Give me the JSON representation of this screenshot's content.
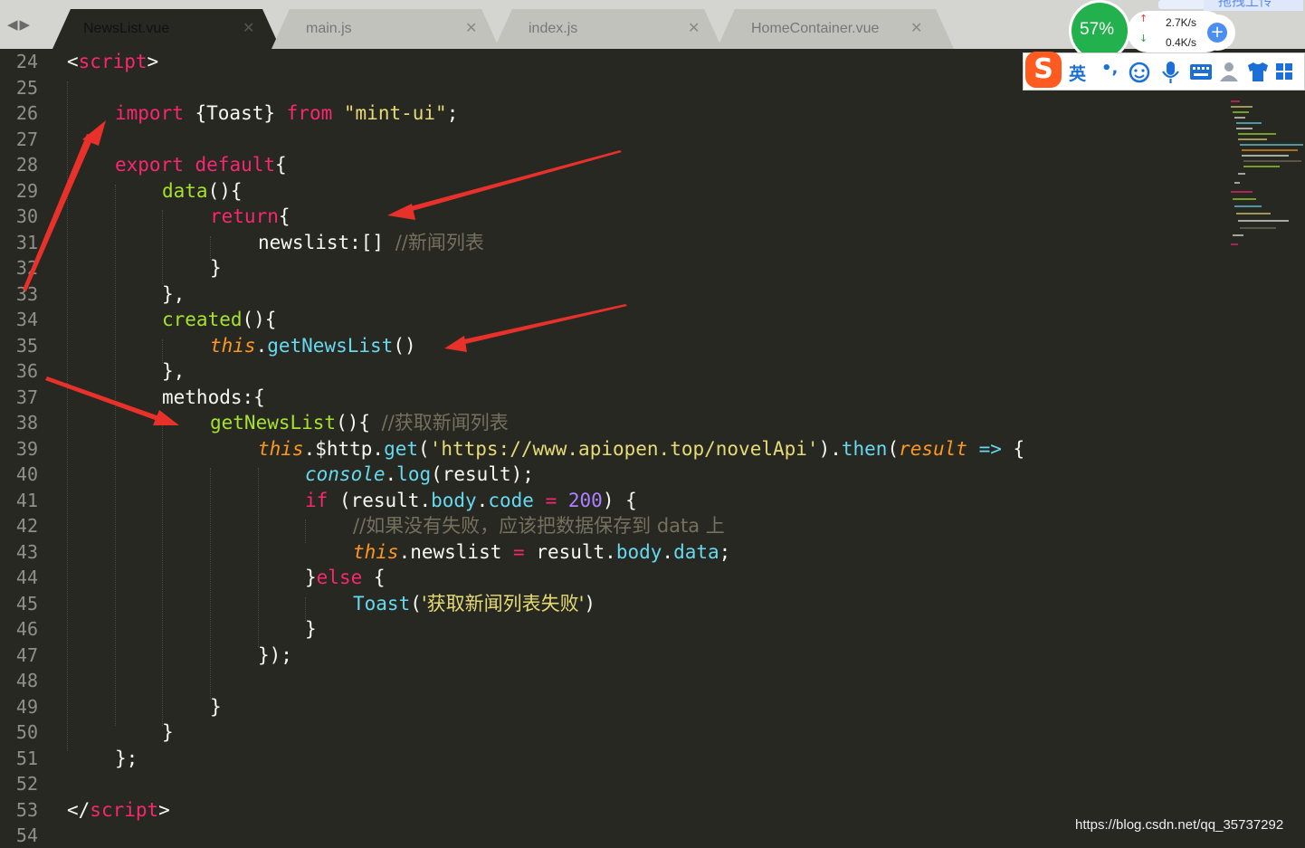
{
  "tabs": [
    {
      "label": "NewsList.vue",
      "active": true
    },
    {
      "label": "main.js",
      "active": false
    },
    {
      "label": "index.js",
      "active": false
    },
    {
      "label": "HomeContainer.vue",
      "active": false
    }
  ],
  "close_glyph": "✕",
  "nav_arrows": "◀▶",
  "line_numbers": [
    "24",
    "25",
    "26",
    "27",
    "28",
    "29",
    "30",
    "31",
    "32",
    "33",
    "34",
    "35",
    "36",
    "37",
    "38",
    "39",
    "40",
    "41",
    "42",
    "43",
    "44",
    "45",
    "46",
    "47",
    "48",
    "49",
    "50",
    "51",
    "52",
    "53",
    "54"
  ],
  "code": {
    "l24": [
      "<",
      "script",
      ">"
    ],
    "l26": [
      "import",
      " {Toast} ",
      "from",
      " ",
      "\"mint-ui\"",
      ";"
    ],
    "l28": [
      "export",
      " ",
      "default",
      "{"
    ],
    "l29": [
      "data",
      "(){"
    ],
    "l30": [
      "return",
      "{"
    ],
    "l31": [
      "newslist:[] ",
      "//新闻列表"
    ],
    "l32": [
      "}"
    ],
    "l33": [
      "},"
    ],
    "l34": [
      "created",
      "(){"
    ],
    "l35": [
      "this",
      ".",
      "getNewsList",
      "()"
    ],
    "l36": [
      "},"
    ],
    "l37": [
      "methods:{"
    ],
    "l38": [
      "getNewsList",
      "(){ ",
      "//获取新闻列表"
    ],
    "l39": [
      "this",
      ".$http.",
      "get",
      "(",
      "'https://www.apiopen.top/novelApi'",
      ").",
      "then",
      "(",
      "result",
      " ",
      "=>",
      " {"
    ],
    "l40": [
      "console",
      ".",
      "log",
      "(result);"
    ],
    "l41": [
      "if",
      " (result.",
      "body",
      ".",
      "code",
      " ",
      "=",
      " ",
      "200",
      ") {"
    ],
    "l42": [
      "//如果没有失败，应该把数据保存到 data 上"
    ],
    "l43": [
      "this",
      ".newslist ",
      "=",
      " result.",
      "body",
      ".",
      "data",
      ";"
    ],
    "l44": [
      "}",
      "else",
      " {"
    ],
    "l45": [
      "Toast",
      "(",
      "'获取新闻列表失败'",
      ")"
    ],
    "l46": [
      "}"
    ],
    "l47": [
      "});"
    ],
    "l49": [
      "}"
    ],
    "l50": [
      "}"
    ],
    "l51": [
      "};"
    ],
    "l53": [
      "</",
      "script",
      ">"
    ]
  },
  "net_monitor": {
    "percent": "57%",
    "upload": "2.7K/s",
    "download": "0.4K/s",
    "drag_label": "拖拽上传",
    "plus": "+"
  },
  "ime_toolbar": {
    "logo": "S",
    "mode": "英",
    "punct": "•,"
  },
  "colors": {
    "editor_bg": "#272822",
    "tab_bar": "#d4d4d0",
    "keyword": "#f92672",
    "string": "#e6db74",
    "function": "#a6e22e",
    "comment": "#75715e",
    "builtin": "#66d9ef",
    "number": "#ae81ff",
    "this": "#fd971f",
    "arrow_annotation": "#e8312a",
    "monitor_green": "#22b14c",
    "ime_orange": "#ff5a1f"
  },
  "watermark": "https://blog.csdn.net/qq_35737292"
}
